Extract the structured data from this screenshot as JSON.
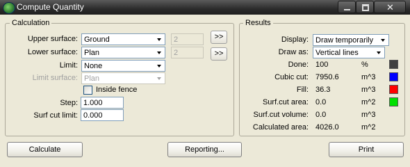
{
  "window": {
    "title": "Compute Quantity"
  },
  "calculation": {
    "group_title": "Calculation",
    "upper_surface": {
      "label": "Upper surface:",
      "value": "Ground",
      "number": "2",
      "button": ">>"
    },
    "lower_surface": {
      "label": "Lower surface:",
      "value": "Plan",
      "number": "2",
      "button": ">>"
    },
    "limit": {
      "label": "Limit:",
      "value": "None"
    },
    "limit_surface": {
      "label": "Limit surface:",
      "value": "Plan"
    },
    "inside_fence": {
      "label": "Inside fence",
      "checked": false
    },
    "step": {
      "label": "Step:",
      "value": "1.000"
    },
    "surf_cut_limit": {
      "label": "Surf cut limit:",
      "value": "0.000"
    }
  },
  "results": {
    "group_title": "Results",
    "display": {
      "label": "Display:",
      "value": "Draw temporarily"
    },
    "draw_as": {
      "label": "Draw as:",
      "value": "Vertical lines"
    },
    "rows": [
      {
        "label": "Done:",
        "value": "100",
        "unit": "%",
        "color": "#404040"
      },
      {
        "label": "Cubic cut:",
        "value": "7950.6",
        "unit": "m^3",
        "color": "#0000ff"
      },
      {
        "label": "Fill:",
        "value": "36.3",
        "unit": "m^3",
        "color": "#ff0000"
      },
      {
        "label": "Surf.cut area:",
        "value": "0.0",
        "unit": "m^2",
        "color": "#00e000"
      },
      {
        "label": "Surf.cut volume:",
        "value": "0.0",
        "unit": "m^3"
      },
      {
        "label": "Calculated area:",
        "value": "4026.0",
        "unit": "m^2"
      }
    ]
  },
  "buttons": {
    "calculate": "Calculate",
    "reporting": "Reporting...",
    "print": "Print"
  }
}
